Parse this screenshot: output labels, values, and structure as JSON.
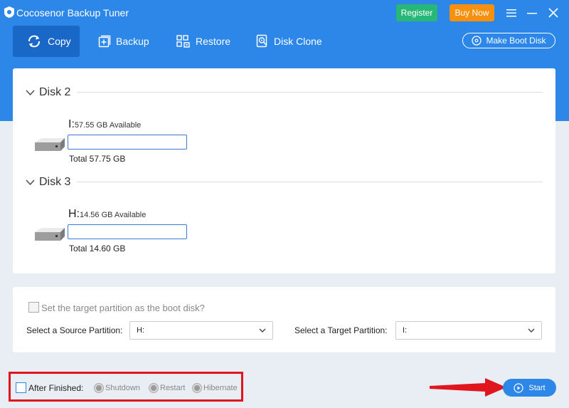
{
  "app": {
    "title": "Cocosenor Backup Tuner",
    "register_label": "Register",
    "buynow_label": "Buy Now"
  },
  "nav": {
    "tabs": [
      {
        "label": "Copy",
        "icon": "copy-icon"
      },
      {
        "label": "Backup",
        "icon": "backup-icon"
      },
      {
        "label": "Restore",
        "icon": "restore-icon"
      },
      {
        "label": "Disk Clone",
        "icon": "disk-clone-icon"
      }
    ],
    "boot_disk_label": "Make Boot Disk"
  },
  "disks": [
    {
      "name": "Disk 2",
      "letter": "I:",
      "available": "57.55 GB Available",
      "total": "Total 57.75 GB"
    },
    {
      "name": "Disk 3",
      "letter": "H:",
      "available": "14.56 GB Available",
      "total": "Total 14.60 GB"
    }
  ],
  "options": {
    "boot_checkbox_label": "Set the target partition as the boot disk?",
    "source_label": "Select a Source Partition:",
    "source_value": "H:",
    "target_label": "Select a Target Partition:",
    "target_value": "I:"
  },
  "footer": {
    "after_finished_label": "After Finished:",
    "radios": [
      "Shutdown",
      "Restart",
      "Hibernate"
    ],
    "start_label": "Start"
  },
  "colors": {
    "brand_blue": "#2c87e8",
    "register_green": "#27b777",
    "buynow_orange": "#f7900f",
    "highlight_red": "#e0151d"
  }
}
